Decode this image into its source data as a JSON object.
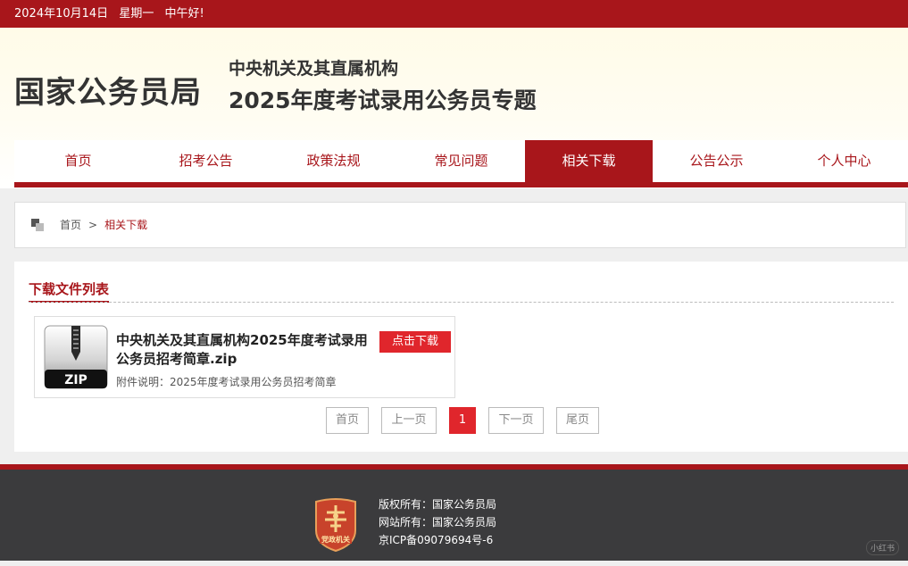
{
  "topbar": {
    "date": "2024年10月14日",
    "weekday": "星期一",
    "greeting": "中午好!"
  },
  "header": {
    "org": "国家公务员局",
    "subtitle1": "中央机关及其直属机构",
    "subtitle2": "2025年度考试录用公务员专题"
  },
  "nav": {
    "items": [
      "首页",
      "招考公告",
      "政策法规",
      "常见问题",
      "相关下载",
      "公告公示",
      "个人中心"
    ],
    "active": "相关下载"
  },
  "breadcrumb": {
    "home": "首页",
    "separator": ">",
    "current": "相关下载"
  },
  "section": {
    "title": "下载文件列表"
  },
  "file": {
    "icon_label": "ZIP",
    "name": "中央机关及其直属机构2025年度考试录用公务员招考简章.zip",
    "description": "附件说明：2025年度考试录用公务员招考简章",
    "download_label": "点击下载"
  },
  "pagination": {
    "first": "首页",
    "prev": "上一页",
    "current": "1",
    "next": "下一页",
    "last": "尾页"
  },
  "footer": {
    "badge_text": "党政机关",
    "copyright": "版权所有：国家公务员局",
    "site": "网站所有：国家公务员局",
    "icp": "京ICP备09079694号-6"
  },
  "watermark": "小红书",
  "colors": {
    "brand_red": "#a8161b",
    "button_red": "#e0262c",
    "footer_bg": "#3b3b3d"
  }
}
